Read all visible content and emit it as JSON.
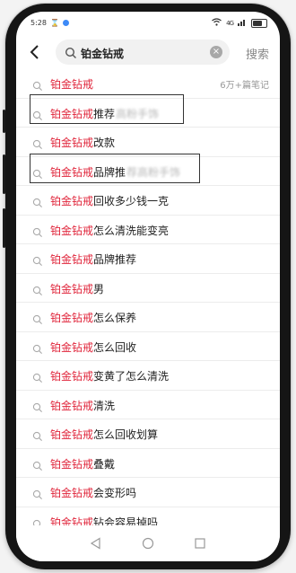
{
  "status": {
    "time": "5:28",
    "signal": "4G"
  },
  "search": {
    "query": "铂金钻戒",
    "button": "搜索"
  },
  "suggestions": [
    {
      "kw": "铂金钻戒",
      "rest": "",
      "blurred": "",
      "meta": "6万+篇笔记"
    },
    {
      "kw": "铂金钻戒",
      "rest": "推荐",
      "blurred": "高粉手饰",
      "meta": ""
    },
    {
      "kw": "铂金钻戒",
      "rest": "改款",
      "blurred": "",
      "meta": ""
    },
    {
      "kw": "铂金钻戒",
      "rest": "品牌推",
      "blurred": "荐高粉手饰",
      "meta": ""
    },
    {
      "kw": "铂金钻戒",
      "rest": "回收多少钱一克",
      "blurred": "",
      "meta": ""
    },
    {
      "kw": "铂金钻戒",
      "rest": "怎么清洗能变亮",
      "blurred": "",
      "meta": ""
    },
    {
      "kw": "铂金钻戒",
      "rest": "品牌推荐",
      "blurred": "",
      "meta": ""
    },
    {
      "kw": "铂金钻戒",
      "rest": "男",
      "blurred": "",
      "meta": ""
    },
    {
      "kw": "铂金钻戒",
      "rest": "怎么保养",
      "blurred": "",
      "meta": ""
    },
    {
      "kw": "铂金钻戒",
      "rest": "怎么回收",
      "blurred": "",
      "meta": ""
    },
    {
      "kw": "铂金钻戒",
      "rest": "变黄了怎么清洗",
      "blurred": "",
      "meta": ""
    },
    {
      "kw": "铂金钻戒",
      "rest": "清洗",
      "blurred": "",
      "meta": ""
    },
    {
      "kw": "铂金钻戒",
      "rest": "怎么回收划算",
      "blurred": "",
      "meta": ""
    },
    {
      "kw": "铂金钻戒",
      "rest": "叠戴",
      "blurred": "",
      "meta": ""
    },
    {
      "kw": "铂金钻戒",
      "rest": "会变形吗",
      "blurred": "",
      "meta": ""
    },
    {
      "kw": "铂金钻戒",
      "rest": "钻会容易掉吗",
      "blurred": "",
      "meta": ""
    }
  ],
  "colors": {
    "keyword": "#e0243a",
    "text": "#222222",
    "meta": "#999999"
  }
}
